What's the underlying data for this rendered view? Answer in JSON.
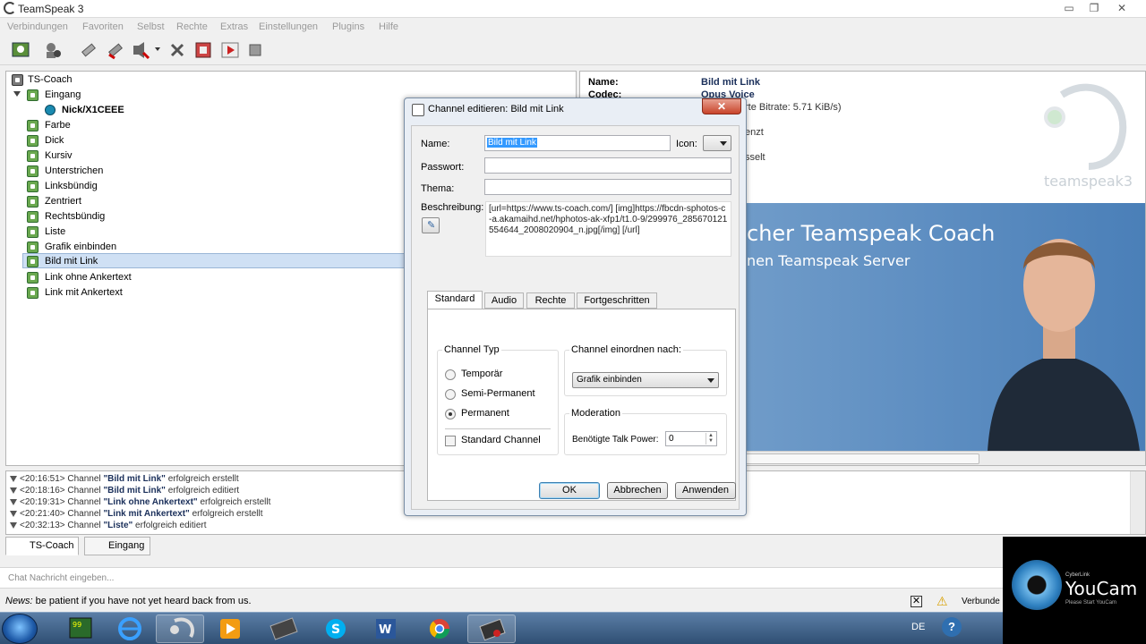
{
  "window": {
    "title": "TeamSpeak 3"
  },
  "menu": [
    "Verbindungen",
    "Favoriten",
    "Selbst",
    "Rechte",
    "Extras",
    "Einstellungen",
    "Plugins",
    "Hilfe"
  ],
  "tree": {
    "server": "TS-Coach",
    "channels": [
      {
        "label": "Eingang",
        "expanded": true
      },
      {
        "label": "Nick/X1CEEE",
        "user": true
      },
      {
        "label": "Farbe"
      },
      {
        "label": "Dick"
      },
      {
        "label": "Kursiv"
      },
      {
        "label": "Unterstrichen"
      },
      {
        "label": "Linksbündig"
      },
      {
        "label": "Zentriert"
      },
      {
        "label": "Rechtsbündig"
      },
      {
        "label": "Liste"
      },
      {
        "label": "Grafik einbinden"
      },
      {
        "label": "Bild mit Link",
        "selected": true
      },
      {
        "label": "Link ohne Ankertext"
      },
      {
        "label": "Link mit Ankertext"
      }
    ]
  },
  "info": {
    "name_label": "Name:",
    "name_value": "Bild mit Link",
    "codec_label": "Codec:",
    "codec_value": "Opus Voice",
    "bitrate_text": "rte Bitrate: 5.71 KiB/s)",
    "frag1": "enzt",
    "frag2": "sselt",
    "banner_title": "cher Teamspeak Coach",
    "banner_sub": "nen Teamspeak Server",
    "logo_text": "teamspeak3"
  },
  "log": [
    {
      "time": "<20:16:51>",
      "pre": "Channel",
      "channel": "\"Bild mit Link\"",
      "msg": "erfolgreich erstellt"
    },
    {
      "time": "<20:18:16>",
      "pre": "Channel",
      "channel": "\"Bild mit Link\"",
      "msg": "erfolgreich editiert"
    },
    {
      "time": "<20:19:31>",
      "pre": "Channel",
      "channel": "\"Link ohne Ankertext\"",
      "msg": "erfolgreich erstellt"
    },
    {
      "time": "<20:21:40>",
      "pre": "Channel",
      "channel": "\"Link mit Ankertext\"",
      "msg": "erfolgreich erstellt"
    },
    {
      "time": "<20:32:13>",
      "pre": "Channel",
      "channel": "\"Liste\"",
      "msg": "erfolgreich editiert"
    }
  ],
  "tabs": {
    "server": "TS-Coach",
    "channel": "Eingang"
  },
  "chat": {
    "placeholder": "Chat Nachricht eingeben..."
  },
  "news": {
    "label": "News:",
    "text": "be patient if you have not yet heard back from us."
  },
  "status": {
    "connected": "Verbunde"
  },
  "dialog": {
    "title": "Channel editieren: Bild mit Link",
    "close": "✕",
    "name_label": "Name:",
    "name_value": "Bild mit Link",
    "icon_label": "Icon:",
    "password_label": "Passwort:",
    "topic_label": "Thema:",
    "desc_label": "Beschreibung:",
    "desc_value": "[url=https://www.ts-coach.com/] [img]https://fbcdn-sphotos-c-a.akamaihd.net/hphotos-ak-xfp1/t1.0-9/299976_285670121554644_2008020904_n.jpg[/img] [/url]",
    "tabs": [
      "Standard",
      "Audio",
      "Rechte",
      "Fortgeschritten"
    ],
    "channel_type_title": "Channel Typ",
    "types": [
      "Temporär",
      "Semi-Permanent",
      "Permanent"
    ],
    "selected_type": "Permanent",
    "standard_channel": "Standard Channel",
    "order_title": "Channel einordnen nach:",
    "order_value": "Grafik einbinden",
    "moderation_title": "Moderation",
    "talk_power_label": "Benötigte Talk Power:",
    "talk_power_value": "0",
    "ok": "OK",
    "cancel": "Abbrechen",
    "apply": "Anwenden"
  },
  "taskbar": {
    "lang": "DE"
  },
  "youcam": {
    "brand": "YouCam",
    "cyberlink": "CyberLink",
    "sub": "Please Start YouCam"
  }
}
